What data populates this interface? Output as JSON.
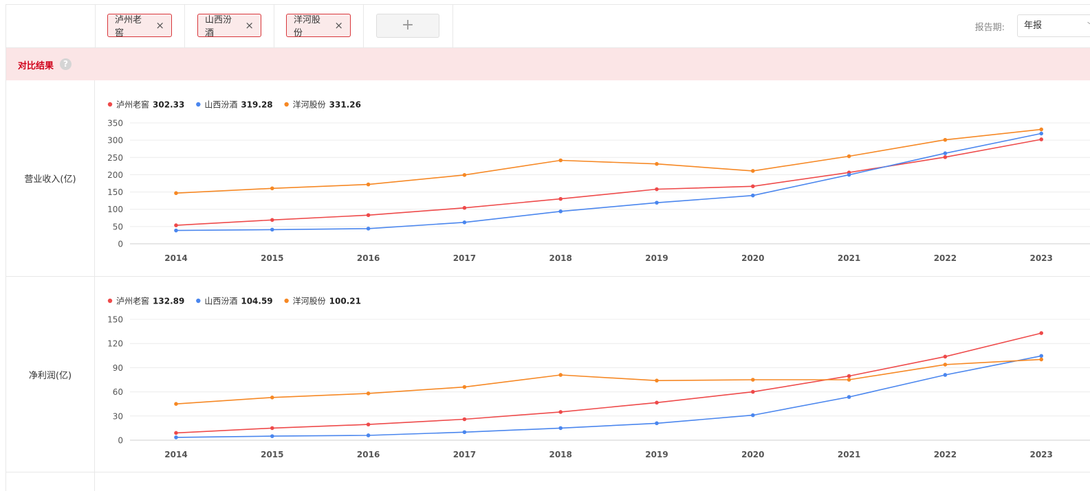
{
  "tags": [
    {
      "label": "泸州老窖"
    },
    {
      "label": "山西汾酒"
    },
    {
      "label": "洋河股份"
    }
  ],
  "add_label": "+",
  "close_glyph": "×",
  "period": {
    "label": "报告期:",
    "value": "年报",
    "chevron": "﹀"
  },
  "banner": {
    "title": "对比结果",
    "help": "?"
  },
  "colors": {
    "泸州老窖": "#ee4a4a",
    "山西汾酒": "#4a86ee",
    "洋河股份": "#f68824"
  },
  "chart_data": [
    {
      "type": "line",
      "row_label": "营业收入(亿)",
      "x": [
        "2014",
        "2015",
        "2016",
        "2017",
        "2018",
        "2019",
        "2020",
        "2021",
        "2022",
        "2023"
      ],
      "yticks": [
        0,
        50,
        100,
        150,
        200,
        250,
        300,
        350
      ],
      "ylim": [
        0,
        350
      ],
      "grid": true,
      "legend_position": "top-left",
      "series": [
        {
          "name": "泸州老窖",
          "latest": "302.33",
          "color": "#ee4a4a",
          "values": [
            53.5,
            69.0,
            83.0,
            104.0,
            130.0,
            158.0,
            166.5,
            206.4,
            251.0,
            302.33
          ]
        },
        {
          "name": "山西汾酒",
          "latest": "319.28",
          "color": "#4a86ee",
          "values": [
            38.5,
            41.0,
            44.0,
            62.0,
            93.8,
            119.0,
            139.9,
            199.7,
            262.1,
            319.28
          ]
        },
        {
          "name": "洋河股份",
          "latest": "331.26",
          "color": "#f68824",
          "values": [
            146.7,
            160.5,
            171.8,
            199.2,
            241.6,
            231.3,
            211.0,
            253.5,
            301.0,
            331.26
          ]
        }
      ]
    },
    {
      "type": "line",
      "row_label": "净利润(亿)",
      "x": [
        "2014",
        "2015",
        "2016",
        "2017",
        "2018",
        "2019",
        "2020",
        "2021",
        "2022",
        "2023"
      ],
      "yticks": [
        0,
        30,
        60,
        90,
        120,
        150
      ],
      "ylim": [
        0,
        150
      ],
      "grid": true,
      "legend_position": "top-left",
      "series": [
        {
          "name": "泸州老窖",
          "latest": "132.89",
          "color": "#ee4a4a",
          "values": [
            9.0,
            15.0,
            19.5,
            26.0,
            35.0,
            46.6,
            60.0,
            79.6,
            103.7,
            132.89
          ]
        },
        {
          "name": "山西汾酒",
          "latest": "104.59",
          "color": "#4a86ee",
          "values": [
            3.5,
            5.0,
            6.0,
            10.0,
            15.0,
            21.0,
            31.0,
            53.6,
            81.0,
            104.59
          ]
        },
        {
          "name": "洋河股份",
          "latest": "100.21",
          "color": "#f68824",
          "values": [
            45.0,
            53.0,
            58.0,
            66.0,
            81.0,
            74.0,
            75.0,
            75.0,
            93.8,
            100.21
          ]
        }
      ]
    }
  ]
}
